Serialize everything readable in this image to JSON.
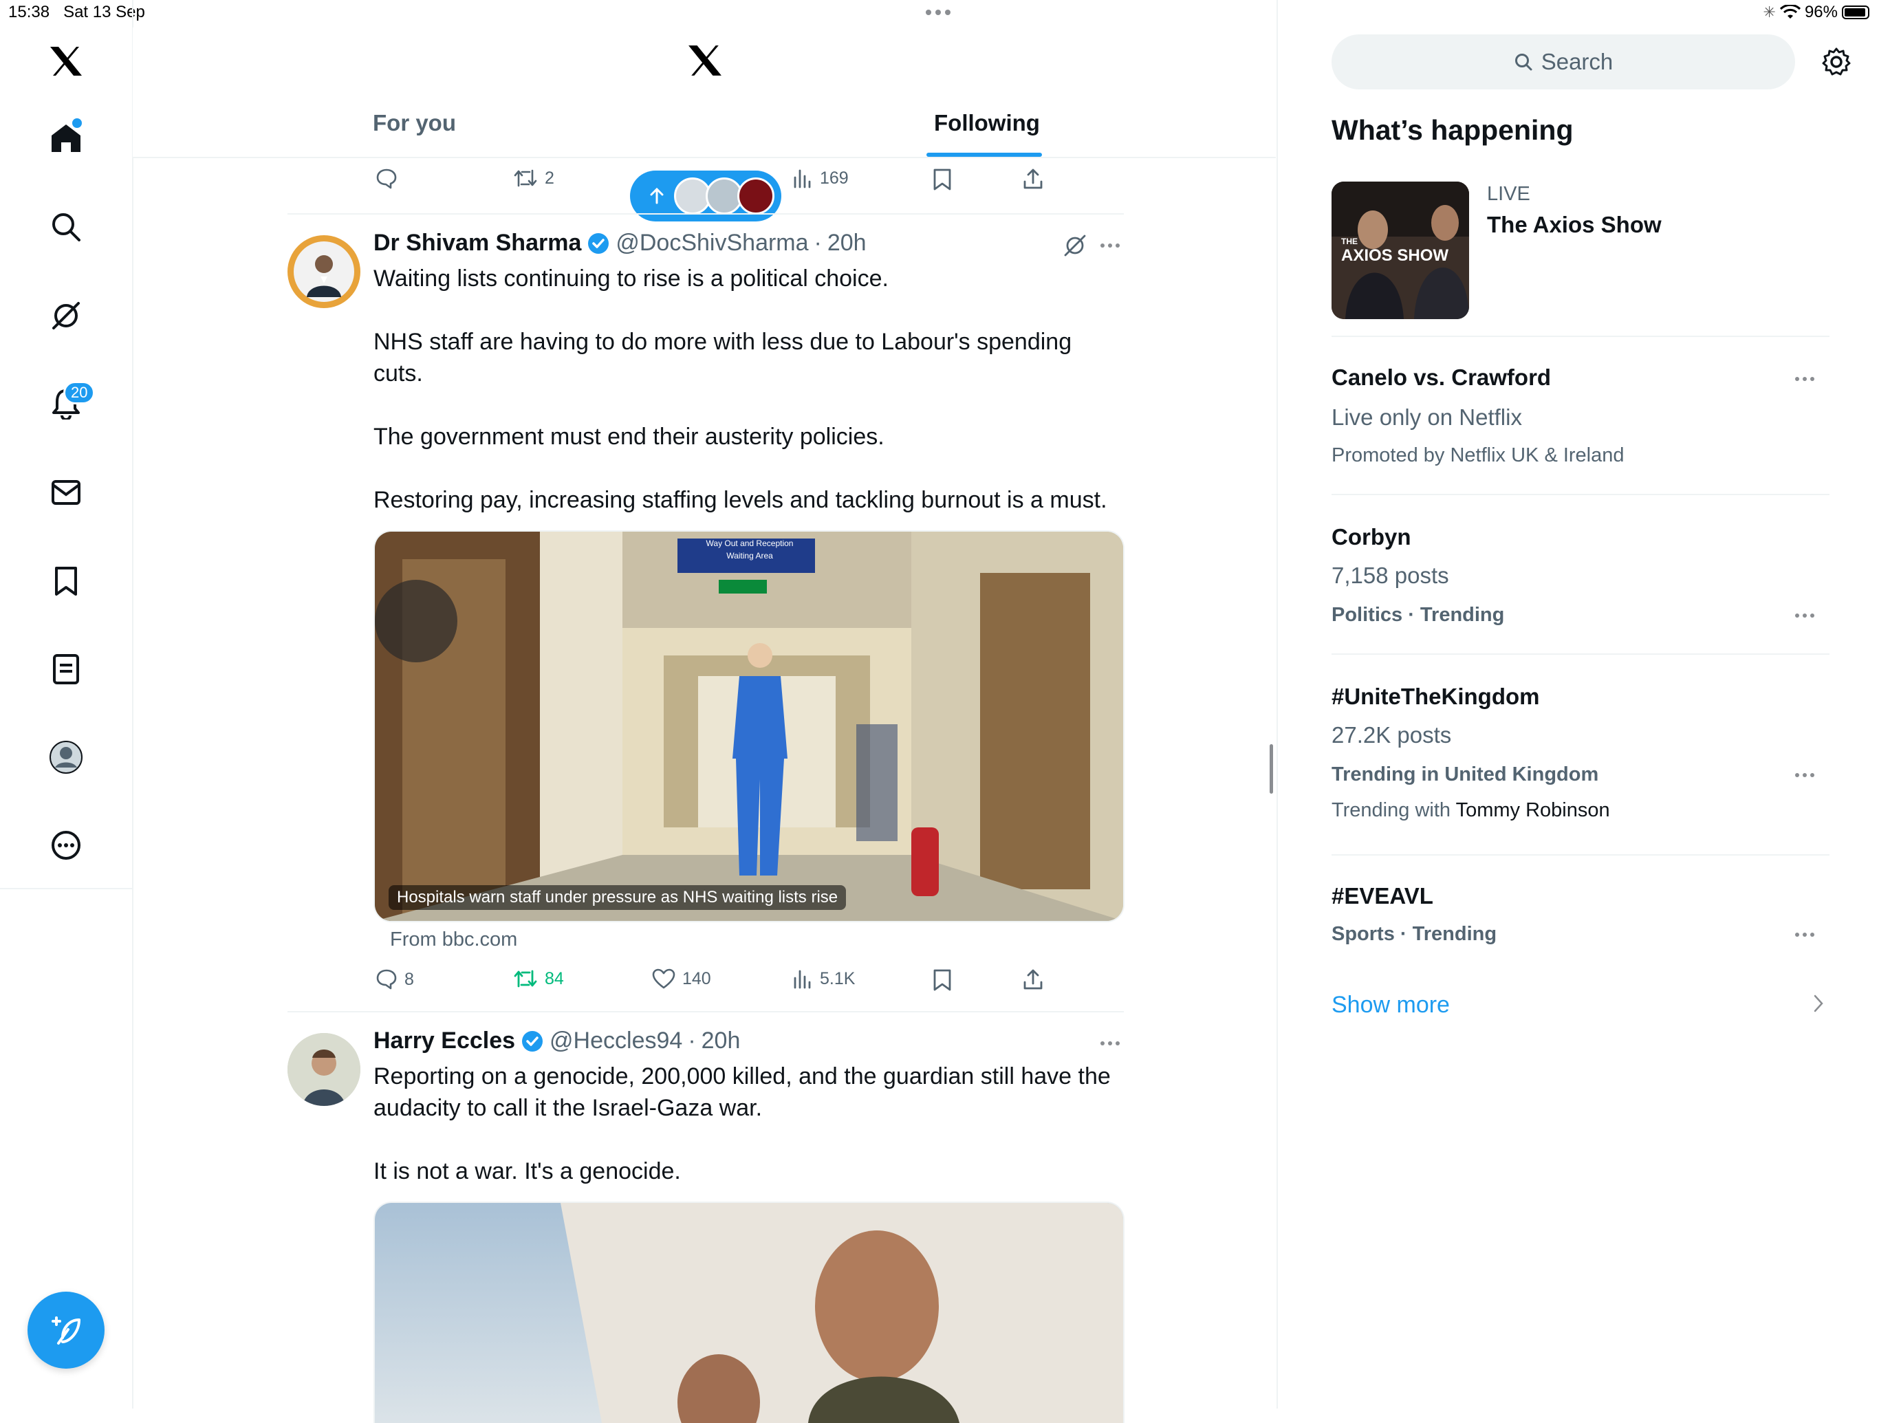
{
  "status": {
    "time": "15:38",
    "date": "Sat 13 Sep",
    "battery": "96%"
  },
  "notifications_badge": "20",
  "tabs": {
    "for_you": "For you",
    "following": "Following"
  },
  "prev_actions": {
    "retweets": "2",
    "views": "169"
  },
  "tweets": [
    {
      "name": "Dr Shivam Sharma",
      "handle": "@DocShivSharma",
      "time": "20h",
      "paragraphs": [
        "Waiting lists continuing to rise is a political choice.",
        "NHS staff are having to do more with less due to Labour's spending cuts.",
        "The government must end their austerity policies.",
        "Restoring pay, increasing staffing levels and tackling burnout is a must."
      ],
      "card_caption": "Hospitals warn staff under pressure as NHS waiting lists rise",
      "card_source": "From bbc.com",
      "sign_top": "Way Out and Reception",
      "sign_bottom": "Waiting Area",
      "replies": "8",
      "retweets": "84",
      "likes": "140",
      "views": "5.1K"
    },
    {
      "name": "Harry Eccles",
      "handle": "@Heccles94",
      "time": "20h",
      "paragraphs": [
        "Reporting on a genocide, 200,000 killed, and the guardian still have the audacity to call it the Israel-Gaza war.",
        "It is not a war. It's a genocide."
      ]
    }
  ],
  "right": {
    "search_placeholder": "Search",
    "title": "What’s happening",
    "live": {
      "label": "LIVE",
      "title": "The Axios Show",
      "thumb_text": "AXIOS SHOW",
      "thumb_small": "THE"
    },
    "trends": [
      {
        "title": "Canelo vs. Crawford",
        "sub": "Live only on Netflix",
        "meta": "Promoted by Netflix UK & Ireland"
      },
      {
        "title": "Corbyn",
        "sub": "7,158 posts",
        "meta": "Politics · Trending"
      },
      {
        "title": "#UniteTheKingdom",
        "sub": "27.2K posts",
        "meta": "Trending in United Kingdom",
        "extra_prefix": "Trending with",
        "extra_name": "Tommy Robinson"
      },
      {
        "title": "#EVEAVL",
        "meta": "Sports · Trending"
      }
    ],
    "show_more": "Show more"
  }
}
